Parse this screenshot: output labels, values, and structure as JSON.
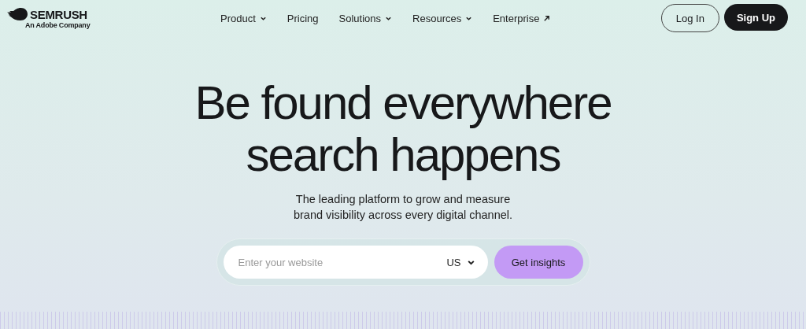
{
  "logo": {
    "name": "SEMRUSH",
    "tagline": "An Adobe Company"
  },
  "nav": [
    {
      "label": "Product",
      "kind": "dropdown"
    },
    {
      "label": "Pricing",
      "kind": "plain"
    },
    {
      "label": "Solutions",
      "kind": "dropdown"
    },
    {
      "label": "Resources",
      "kind": "dropdown"
    },
    {
      "label": "Enterprise",
      "kind": "external"
    }
  ],
  "auth": {
    "login": "Log In",
    "signup": "Sign Up"
  },
  "hero": {
    "headline": [
      "Be found everywhere",
      "search happens"
    ],
    "subtitle": [
      "The leading platform to grow and measure",
      "brand visibility across every digital channel."
    ]
  },
  "search": {
    "placeholder": "Enter your website",
    "country": "US",
    "button": "Get insights"
  }
}
